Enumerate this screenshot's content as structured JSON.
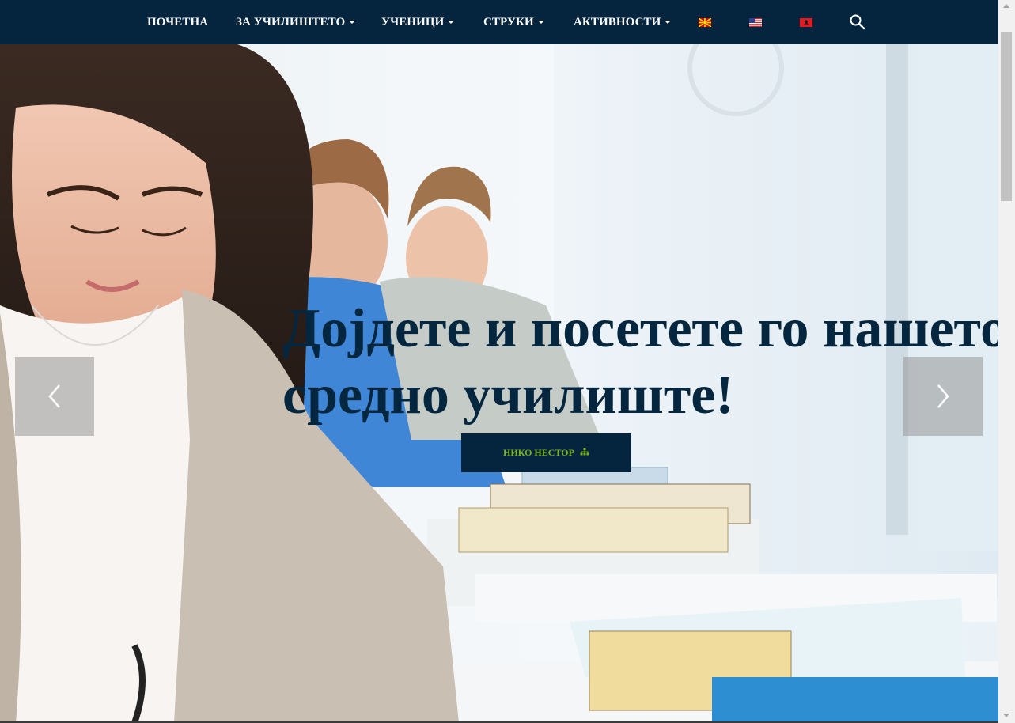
{
  "nav": {
    "items": [
      {
        "label": "ПОЧЕТНА",
        "dropdown": false
      },
      {
        "label": "ЗА УЧИЛИШТЕТО",
        "dropdown": true
      },
      {
        "label": "УЧЕНИЦИ",
        "dropdown": true
      },
      {
        "label": "СТРУКИ",
        "dropdown": true
      },
      {
        "label": "АКТИВНОСТИ",
        "dropdown": true
      }
    ],
    "languages": [
      "flag-macedonia-icon",
      "flag-usa-icon",
      "flag-albania-icon"
    ],
    "search_icon": "search-icon"
  },
  "hero": {
    "title_line1": "Дојдете и посетете го нашето",
    "title_line2": "средно училиште!",
    "cta_label": "НИКО НЕСТОР",
    "cta_icon": "sitemap-icon",
    "prev_icon": "chevron-left-icon",
    "next_icon": "chevron-right-icon"
  },
  "colors": {
    "nav_bg": "#05253f",
    "title": "#04263f",
    "cta_text": "#7ab317"
  }
}
